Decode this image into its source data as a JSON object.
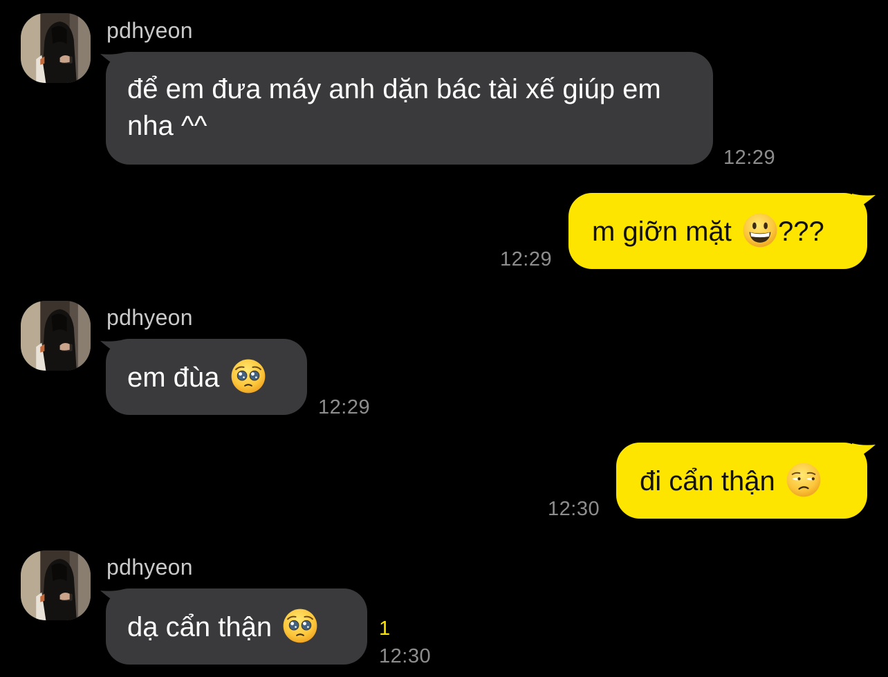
{
  "chat": {
    "messages": [
      {
        "sender": "pdhyeon",
        "text": "để em đưa máy anh dặn bác tài xế giúp em nha ^^",
        "time": "12:29"
      },
      {
        "text": "m giỡn mặt",
        "suffix": "???",
        "emoji": "grinning-face-emoji",
        "time": "12:29"
      },
      {
        "sender": "pdhyeon",
        "text": "em đùa",
        "emoji": "pleading-face-emoji",
        "time": "12:29"
      },
      {
        "text": "đi cẩn thận",
        "emoji": "unamused-face-emoji",
        "time": "12:30"
      },
      {
        "sender": "pdhyeon",
        "text": "dạ cẩn thận",
        "emoji": "pleading-face-emoji",
        "time": "12:30",
        "unread_count": "1"
      }
    ]
  },
  "colors": {
    "background": "#000000",
    "incoming_bubble": "#3a3a3c",
    "outgoing_bubble": "#fde500",
    "timestamp": "#8d8d8d",
    "unread": "#fde500"
  }
}
